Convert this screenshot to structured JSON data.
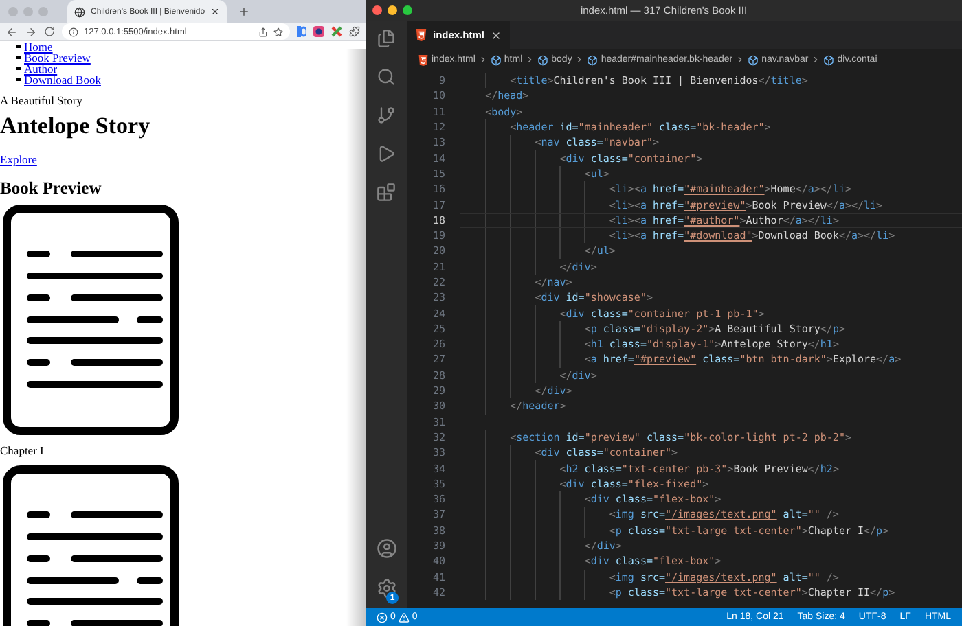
{
  "browser": {
    "tab": {
      "title": "Children's Book III | Bienvenido",
      "selected": true
    },
    "url": "127.0.0.1:5500/index.html",
    "page": {
      "nav_links": [
        "Home",
        "Book Preview",
        "Author",
        "Download Book"
      ],
      "tagline": "A Beautiful Story",
      "heading": "Antelope Story",
      "link": "Explore",
      "section_heading": "Book Preview",
      "content": [
        {
          "kind": "image"
        },
        {
          "kind": "caption",
          "text": "Chapter I"
        },
        {
          "kind": "image"
        }
      ]
    }
  },
  "editor": {
    "window_title": "index.html — 317 Children's Book III",
    "tabs": [
      {
        "label": "index.html",
        "selected": true
      }
    ],
    "breadcrumbs": [
      "index.html",
      "html",
      "body",
      "header#mainheader.bk-header",
      "nav.navbar",
      "div.contai"
    ],
    "settings_badge": "1",
    "lines": [
      {
        "number": "9",
        "current": false,
        "tokens": [
          {
            "kind": "tag",
            "text": "        <title>"
          },
          {
            "kind": "text",
            "text": "Children's Book III | Bienvenidos"
          },
          {
            "kind": "tag",
            "text": "</title>"
          }
        ]
      },
      {
        "number": "10",
        "current": false,
        "tokens": [
          {
            "kind": "tag",
            "text": "    </head>"
          }
        ]
      },
      {
        "number": "11",
        "current": false,
        "tokens": [
          {
            "kind": "tag",
            "text": "    <body>"
          }
        ]
      },
      {
        "number": "12",
        "current": false,
        "tokens": [
          {
            "kind": "tag",
            "text": "        <header"
          },
          {
            "kind": "attr",
            "text": " id="
          },
          {
            "kind": "str",
            "text": "\"mainheader\""
          },
          {
            "kind": "attr",
            "text": " class="
          },
          {
            "kind": "str",
            "text": "\"bk-header\""
          },
          {
            "kind": "tag",
            "text": ">"
          }
        ]
      },
      {
        "number": "13",
        "current": false,
        "tokens": [
          {
            "kind": "tag",
            "text": "            <nav"
          },
          {
            "kind": "attr",
            "text": " class="
          },
          {
            "kind": "str",
            "text": "\"navbar\""
          },
          {
            "kind": "tag",
            "text": ">"
          }
        ]
      },
      {
        "number": "14",
        "current": false,
        "tokens": [
          {
            "kind": "tag",
            "text": "                <div"
          },
          {
            "kind": "attr",
            "text": " class="
          },
          {
            "kind": "str",
            "text": "\"container\""
          },
          {
            "kind": "tag",
            "text": ">"
          }
        ]
      },
      {
        "number": "15",
        "current": false,
        "tokens": [
          {
            "kind": "tag",
            "text": "                    <ul>"
          }
        ]
      },
      {
        "number": "16",
        "current": false,
        "tokens": [
          {
            "kind": "tag",
            "text": "                        <li><a"
          },
          {
            "kind": "attr",
            "text": " href="
          },
          {
            "kind": "link",
            "text": "\"#mainheader\""
          },
          {
            "kind": "tag",
            "text": ">"
          },
          {
            "kind": "text",
            "text": "Home"
          },
          {
            "kind": "tag",
            "text": "</a></li>"
          }
        ]
      },
      {
        "number": "17",
        "current": false,
        "tokens": [
          {
            "kind": "tag",
            "text": "                        <li><a"
          },
          {
            "kind": "attr",
            "text": " href="
          },
          {
            "kind": "link",
            "text": "\"#preview\""
          },
          {
            "kind": "tag",
            "text": ">"
          },
          {
            "kind": "text",
            "text": "Book Preview"
          },
          {
            "kind": "tag",
            "text": "</a></li>"
          }
        ]
      },
      {
        "number": "18",
        "current": true,
        "tokens": [
          {
            "kind": "tag",
            "text": "                        <li><a"
          },
          {
            "kind": "attr",
            "text": " href="
          },
          {
            "kind": "link",
            "text": "\"#author\""
          },
          {
            "kind": "tag",
            "text": ">"
          },
          {
            "kind": "text",
            "text": "Author"
          },
          {
            "kind": "tag",
            "text": "</a></li>"
          }
        ]
      },
      {
        "number": "19",
        "current": false,
        "tokens": [
          {
            "kind": "tag",
            "text": "                        <li><a"
          },
          {
            "kind": "attr",
            "text": " href="
          },
          {
            "kind": "link",
            "text": "\"#download\""
          },
          {
            "kind": "tag",
            "text": ">"
          },
          {
            "kind": "text",
            "text": "Download Book"
          },
          {
            "kind": "tag",
            "text": "</a></li>"
          }
        ]
      },
      {
        "number": "20",
        "current": false,
        "tokens": [
          {
            "kind": "tag",
            "text": "                    </ul>"
          }
        ]
      },
      {
        "number": "21",
        "current": false,
        "tokens": [
          {
            "kind": "tag",
            "text": "                </div>"
          }
        ]
      },
      {
        "number": "22",
        "current": false,
        "tokens": [
          {
            "kind": "tag",
            "text": "            </nav>"
          }
        ]
      },
      {
        "number": "23",
        "current": false,
        "tokens": [
          {
            "kind": "tag",
            "text": "            <div"
          },
          {
            "kind": "attr",
            "text": " id="
          },
          {
            "kind": "str",
            "text": "\"showcase\""
          },
          {
            "kind": "tag",
            "text": ">"
          }
        ]
      },
      {
        "number": "24",
        "current": false,
        "tokens": [
          {
            "kind": "tag",
            "text": "                <div"
          },
          {
            "kind": "attr",
            "text": " class="
          },
          {
            "kind": "str",
            "text": "\"container pt-1 pb-1\""
          },
          {
            "kind": "tag",
            "text": ">"
          }
        ]
      },
      {
        "number": "25",
        "current": false,
        "tokens": [
          {
            "kind": "tag",
            "text": "                    <p"
          },
          {
            "kind": "attr",
            "text": " class="
          },
          {
            "kind": "str",
            "text": "\"display-2\""
          },
          {
            "kind": "tag",
            "text": ">"
          },
          {
            "kind": "text",
            "text": "A Beautiful Story"
          },
          {
            "kind": "tag",
            "text": "</p>"
          }
        ]
      },
      {
        "number": "26",
        "current": false,
        "tokens": [
          {
            "kind": "tag",
            "text": "                    <h1"
          },
          {
            "kind": "attr",
            "text": " class="
          },
          {
            "kind": "str",
            "text": "\"display-1\""
          },
          {
            "kind": "tag",
            "text": ">"
          },
          {
            "kind": "text",
            "text": "Antelope Story"
          },
          {
            "kind": "tag",
            "text": "</h1>"
          }
        ]
      },
      {
        "number": "27",
        "current": false,
        "tokens": [
          {
            "kind": "tag",
            "text": "                    <a"
          },
          {
            "kind": "attr",
            "text": " href="
          },
          {
            "kind": "link",
            "text": "\"#preview\""
          },
          {
            "kind": "attr",
            "text": " class="
          },
          {
            "kind": "str",
            "text": "\"btn btn-dark\""
          },
          {
            "kind": "tag",
            "text": ">"
          },
          {
            "kind": "text",
            "text": "Explore"
          },
          {
            "kind": "tag",
            "text": "</a>"
          }
        ]
      },
      {
        "number": "28",
        "current": false,
        "tokens": [
          {
            "kind": "tag",
            "text": "                </div>"
          }
        ]
      },
      {
        "number": "29",
        "current": false,
        "tokens": [
          {
            "kind": "tag",
            "text": "            </div>"
          }
        ]
      },
      {
        "number": "30",
        "current": false,
        "tokens": [
          {
            "kind": "tag",
            "text": "        </header>"
          }
        ]
      },
      {
        "number": "31",
        "current": false
      },
      {
        "number": "32",
        "current": false,
        "tokens": [
          {
            "kind": "tag",
            "text": "        <section"
          },
          {
            "kind": "attr",
            "text": " id="
          },
          {
            "kind": "str",
            "text": "\"preview\""
          },
          {
            "kind": "attr",
            "text": " class="
          },
          {
            "kind": "str",
            "text": "\"bk-color-light pt-2 pb-2\""
          },
          {
            "kind": "tag",
            "text": ">"
          }
        ]
      },
      {
        "number": "33",
        "current": false,
        "tokens": [
          {
            "kind": "tag",
            "text": "            <div"
          },
          {
            "kind": "attr",
            "text": " class="
          },
          {
            "kind": "str",
            "text": "\"container\""
          },
          {
            "kind": "tag",
            "text": ">"
          }
        ]
      },
      {
        "number": "34",
        "current": false,
        "tokens": [
          {
            "kind": "tag",
            "text": "                <h2"
          },
          {
            "kind": "attr",
            "text": " class="
          },
          {
            "kind": "str",
            "text": "\"txt-center pb-3\""
          },
          {
            "kind": "tag",
            "text": ">"
          },
          {
            "kind": "text",
            "text": "Book Preview"
          },
          {
            "kind": "tag",
            "text": "</h2>"
          }
        ]
      },
      {
        "number": "35",
        "current": false,
        "tokens": [
          {
            "kind": "tag",
            "text": "                <div"
          },
          {
            "kind": "attr",
            "text": " class="
          },
          {
            "kind": "str",
            "text": "\"flex-fixed\""
          },
          {
            "kind": "tag",
            "text": ">"
          }
        ]
      },
      {
        "number": "36",
        "current": false,
        "tokens": [
          {
            "kind": "tag",
            "text": "                    <div"
          },
          {
            "kind": "attr",
            "text": " class="
          },
          {
            "kind": "str",
            "text": "\"flex-box\""
          },
          {
            "kind": "tag",
            "text": ">"
          }
        ]
      },
      {
        "number": "37",
        "current": false,
        "tokens": [
          {
            "kind": "tag",
            "text": "                        <img"
          },
          {
            "kind": "attr",
            "text": " src="
          },
          {
            "kind": "link",
            "text": "\"/images/text.png\""
          },
          {
            "kind": "attr",
            "text": " alt="
          },
          {
            "kind": "str",
            "text": "\"\""
          },
          {
            "kind": "tag",
            "text": " />"
          }
        ]
      },
      {
        "number": "38",
        "current": false,
        "tokens": [
          {
            "kind": "tag",
            "text": "                        <p"
          },
          {
            "kind": "attr",
            "text": " class="
          },
          {
            "kind": "str",
            "text": "\"txt-large txt-center\""
          },
          {
            "kind": "tag",
            "text": ">"
          },
          {
            "kind": "text",
            "text": "Chapter I"
          },
          {
            "kind": "tag",
            "text": "</p>"
          }
        ]
      },
      {
        "number": "39",
        "current": false,
        "tokens": [
          {
            "kind": "tag",
            "text": "                    </div>"
          }
        ]
      },
      {
        "number": "40",
        "current": false,
        "tokens": [
          {
            "kind": "tag",
            "text": "                    <div"
          },
          {
            "kind": "attr",
            "text": " class="
          },
          {
            "kind": "str",
            "text": "\"flex-box\""
          },
          {
            "kind": "tag",
            "text": ">"
          }
        ]
      },
      {
        "number": "41",
        "current": false,
        "tokens": [
          {
            "kind": "tag",
            "text": "                        <img"
          },
          {
            "kind": "attr",
            "text": " src="
          },
          {
            "kind": "link",
            "text": "\"/images/text.png\""
          },
          {
            "kind": "attr",
            "text": " alt="
          },
          {
            "kind": "str",
            "text": "\"\""
          },
          {
            "kind": "tag",
            "text": " />"
          }
        ]
      },
      {
        "number": "42",
        "current": false,
        "tokens": [
          {
            "kind": "tag",
            "text": "                        <p"
          },
          {
            "kind": "attr",
            "text": " class="
          },
          {
            "kind": "str",
            "text": "\"txt-large txt-center\""
          },
          {
            "kind": "tag",
            "text": ">"
          },
          {
            "kind": "text",
            "text": "Chapter II"
          },
          {
            "kind": "tag",
            "text": "</p>"
          }
        ]
      }
    ],
    "status": {
      "errors": "0",
      "warnings": "0",
      "items": [
        "Ln 18, Col 21",
        "Tab Size: 4",
        "UTF-8",
        "LF",
        "HTML"
      ]
    }
  }
}
